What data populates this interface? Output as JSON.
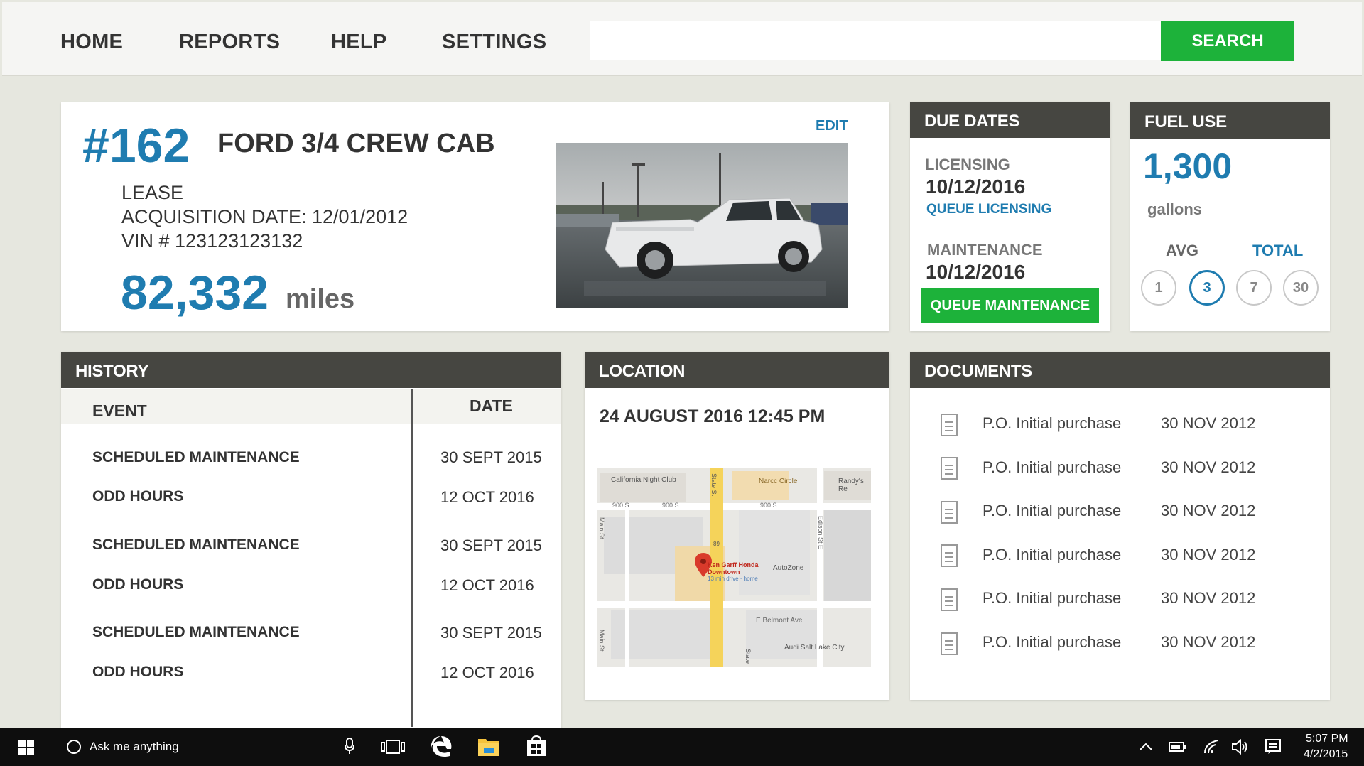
{
  "nav": {
    "items": [
      "HOME",
      "REPORTS",
      "HELP",
      "SETTINGS"
    ],
    "search_placeholder": "",
    "search_label": "SEARCH",
    "accent": "#1db23a"
  },
  "vehicle": {
    "number": "#162",
    "name": "FORD 3/4 CREW CAB",
    "edit_label": "EDIT",
    "ownership": "LEASE",
    "acquisition": "ACQUISITION DATE: 12/01/2012",
    "vin": "VIN # 123123123132",
    "miles_value": "82,332",
    "miles_unit": "miles",
    "accent": "#1f7cb0"
  },
  "due_dates": {
    "title": "DUE DATES",
    "licensing_label": "LICENSING",
    "licensing_date": "10/12/2016",
    "licensing_link": "QUEUE LICENSING",
    "maintenance_label": "MAINTENANCE",
    "maintenance_date": "10/12/2016",
    "maintenance_button": "QUEUE MAINTENANCE"
  },
  "fuel": {
    "title": "FUEL USE",
    "value": "1,300",
    "unit": "gallons",
    "tab_avg": "AVG",
    "tab_total": "TOTAL",
    "periods": [
      "1",
      "3",
      "7",
      "30"
    ],
    "selected_period": "3"
  },
  "history": {
    "title": "HISTORY",
    "col_event": "EVENT",
    "col_date": "DATE",
    "rows": [
      {
        "event": "SCHEDULED MAINTENANCE",
        "date": "30 SEPT 2015"
      },
      {
        "event": "ODD HOURS",
        "date": "12 OCT 2016"
      },
      {
        "event": "SCHEDULED MAINTENANCE",
        "date": "30 SEPT 2015"
      },
      {
        "event": "ODD HOURS",
        "date": "12 OCT 2016"
      },
      {
        "event": "SCHEDULED MAINTENANCE",
        "date": "30 SEPT 2015"
      },
      {
        "event": "ODD HOURS",
        "date": "12 OCT 2016"
      }
    ]
  },
  "location": {
    "title": "LOCATION",
    "timestamp": "24 AUGUST 2016  12:45 PM",
    "map_labels": {
      "club": "California Night Club",
      "circle": "Narcc Circle",
      "randys": "Randy's Re",
      "street_900a": "900 S",
      "street_900b": "900 S",
      "street_900c": "900 S",
      "state_st": "State St",
      "main_st": "Main St",
      "main_st2": "Main St",
      "edison": "Edison St E",
      "pin_name": "Ken Garff Honda Downtown",
      "pin_sub": "13 min drive · home",
      "autozone": "AutoZone",
      "belmont": "E Belmont Ave",
      "audi": "Audi Salt Lake City",
      "route": "89",
      "state_st2": "State"
    }
  },
  "documents": {
    "title": "DOCUMENTS",
    "rows": [
      {
        "name": "P.O. Initial purchase",
        "date": "30 NOV 2012"
      },
      {
        "name": "P.O. Initial purchase",
        "date": "30 NOV 2012"
      },
      {
        "name": "P.O. Initial purchase",
        "date": "30 NOV 2012"
      },
      {
        "name": "P.O. Initial purchase",
        "date": "30 NOV 2012"
      },
      {
        "name": "P.O. Initial purchase",
        "date": "30 NOV 2012"
      },
      {
        "name": "P.O. Initial purchase",
        "date": "30 NOV 2012"
      }
    ]
  },
  "taskbar": {
    "cortana_text": "Ask me anything",
    "time": "5:07 PM",
    "date": "4/2/2015",
    "icons": [
      "windows-start-icon",
      "cortana-circle-icon",
      "microphone-icon",
      "task-view-icon",
      "edge-icon",
      "file-explorer-icon",
      "store-icon",
      "chevron-up-icon",
      "battery-icon",
      "wifi-icon",
      "volume-icon",
      "action-center-icon"
    ]
  }
}
